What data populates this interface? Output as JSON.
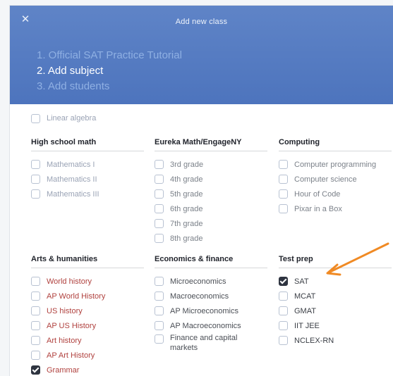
{
  "dialog": {
    "close_glyph": "✕",
    "title": "Add new class"
  },
  "steps": [
    {
      "label": "1. Official SAT Practice Tutorial",
      "state": "done"
    },
    {
      "label": "2. Add subject",
      "state": "active"
    },
    {
      "label": "3. Add students",
      "state": "pending"
    }
  ],
  "top_items": [
    {
      "label": "Linear algebra",
      "checked": false
    }
  ],
  "columns": [
    {
      "heading": "High school math",
      "items": [
        {
          "label": "Mathematics I",
          "checked": false
        },
        {
          "label": "Mathematics II",
          "checked": false
        },
        {
          "label": "Mathematics III",
          "checked": false
        }
      ]
    },
    {
      "heading": "Eureka Math/EngageNY",
      "items": [
        {
          "label": "3rd grade",
          "checked": false
        },
        {
          "label": "4th grade",
          "checked": false
        },
        {
          "label": "5th grade",
          "checked": false
        },
        {
          "label": "6th grade",
          "checked": false
        },
        {
          "label": "7th grade",
          "checked": false
        },
        {
          "label": "8th grade",
          "checked": false
        }
      ]
    },
    {
      "heading": "Computing",
      "items": [
        {
          "label": "Computer programming",
          "checked": false
        },
        {
          "label": "Computer science",
          "checked": false
        },
        {
          "label": "Hour of Code",
          "checked": false
        },
        {
          "label": "Pixar in a Box",
          "checked": false
        }
      ]
    },
    {
      "heading": "Arts & humanities",
      "items": [
        {
          "label": "World history",
          "checked": false
        },
        {
          "label": "AP World History",
          "checked": false
        },
        {
          "label": "US history",
          "checked": false
        },
        {
          "label": "AP US History",
          "checked": false
        },
        {
          "label": "Art history",
          "checked": false
        },
        {
          "label": "AP Art History",
          "checked": false
        },
        {
          "label": "Grammar",
          "checked": true
        }
      ]
    },
    {
      "heading": "Economics & finance",
      "items": [
        {
          "label": "Microeconomics",
          "checked": false
        },
        {
          "label": "Macroeconomics",
          "checked": false
        },
        {
          "label": "AP Microeconomics",
          "checked": false
        },
        {
          "label": "AP Macroeconomics",
          "checked": false
        },
        {
          "label": "Finance and capital markets",
          "checked": false
        }
      ]
    },
    {
      "heading": "Test prep",
      "items": [
        {
          "label": "SAT",
          "checked": true
        },
        {
          "label": "MCAT",
          "checked": false
        },
        {
          "label": "GMAT",
          "checked": false
        },
        {
          "label": "IIT JEE",
          "checked": false
        },
        {
          "label": "NCLEX-RN",
          "checked": false
        }
      ]
    }
  ],
  "colors": {
    "header": "#5079c0",
    "arts_label": "#b0413e",
    "arrow": "#f08a24"
  }
}
